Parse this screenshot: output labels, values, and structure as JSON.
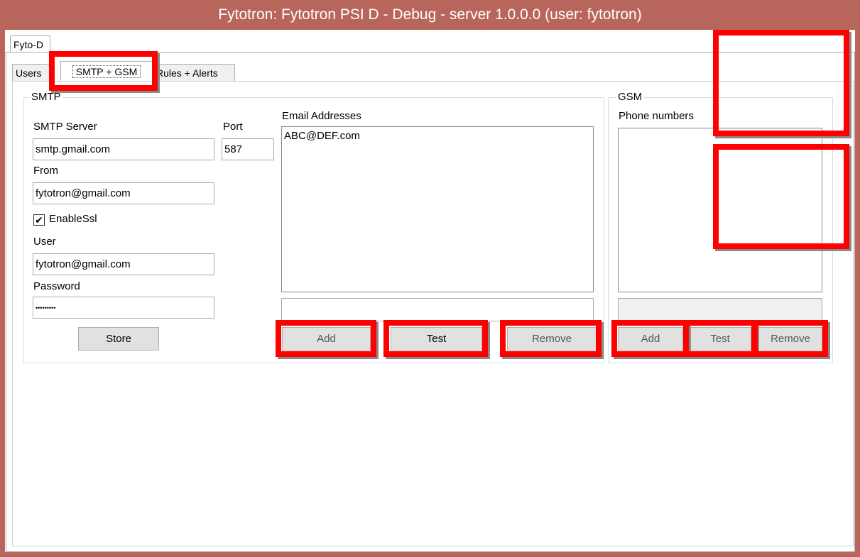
{
  "window": {
    "title": "Fytotron: Fytotron PSI D - Debug - server  1.0.0.0 (user: fytotron)"
  },
  "outer_tab": {
    "label": "Fyto-D"
  },
  "tabs": [
    {
      "label": "Users"
    },
    {
      "label": "SMTP + GSM"
    },
    {
      "label": "Rules + Alerts"
    }
  ],
  "smtp": {
    "legend": "SMTP",
    "server_label": "SMTP Server",
    "server_value": "smtp.gmail.com",
    "port_label": "Port",
    "port_value": "587",
    "from_label": "From",
    "from_value": "fytotron@gmail.com",
    "enable_ssl_label": "EnableSsl",
    "enable_ssl_checked": true,
    "user_label": "User",
    "user_value": "fytotron@gmail.com",
    "password_label": "Password",
    "password_value": "•••••••••",
    "store_label": "Store",
    "emails_label": "Email Addresses",
    "emails": [
      "ABC@DEF.com"
    ],
    "email_input_value": "",
    "add_label": "Add",
    "test_label": "Test",
    "remove_label": "Remove"
  },
  "gsm": {
    "legend": "GSM",
    "phones_label": "Phone numbers",
    "phones": [],
    "add_label": "Add",
    "test_label": "Test",
    "remove_label": "Remove"
  },
  "colors": {
    "title_bar": "#b8665c",
    "highlight": "#ff0000"
  }
}
